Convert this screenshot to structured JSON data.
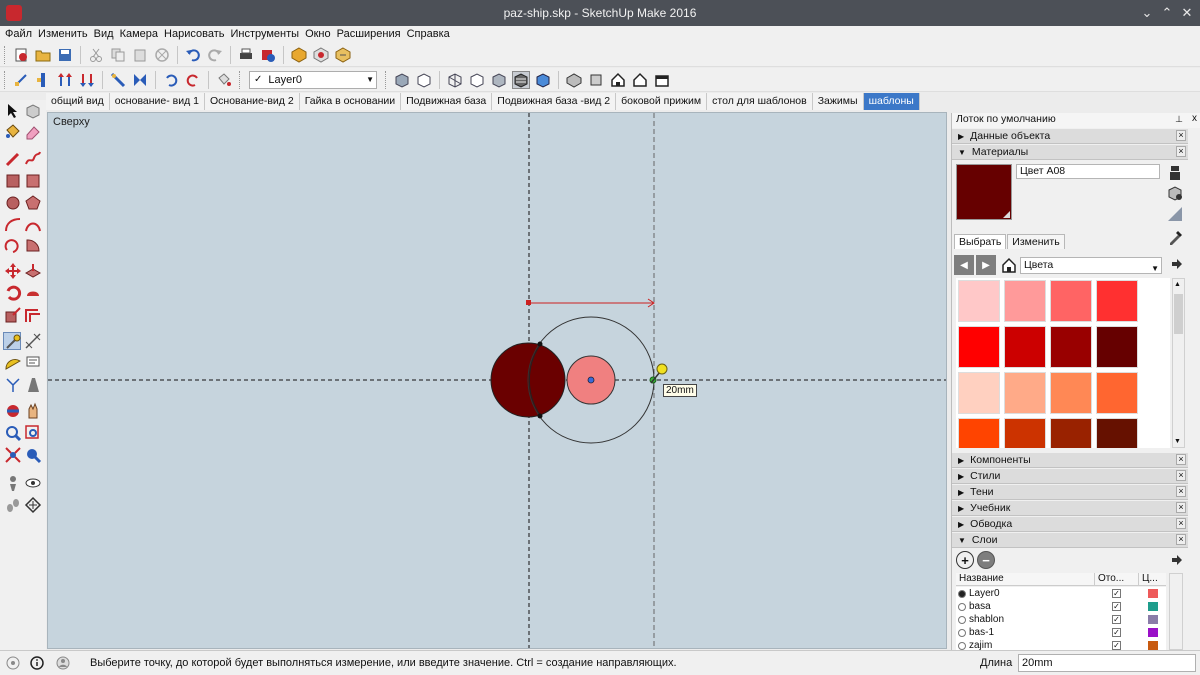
{
  "window": {
    "title": "paz-ship.skp - SketchUp Make 2016",
    "minimize": "⌄",
    "maximize": "⌃",
    "close": "✕"
  },
  "menu": [
    "Файл",
    "Изменить",
    "Вид",
    "Камера",
    "Нарисовать",
    "Инструменты",
    "Окно",
    "Расширения",
    "Справка"
  ],
  "layer_select": {
    "value": "Layer0",
    "check": "✓"
  },
  "scenes": [
    "общий вид",
    "основание- вид 1",
    "Основание-вид 2",
    "Гайка в основании",
    "Подвижная база",
    "Подвижная база -вид 2",
    "боковой прижим",
    "стол для шаблонов",
    "Зажимы",
    "шаблоны"
  ],
  "active_scene": "шаблоны",
  "viewport": {
    "view_label": "Сверху",
    "tooltip": "20mm"
  },
  "tray": {
    "title": "Лоток по умолчанию",
    "pin": "⊥",
    "close": "x",
    "sections": {
      "entity_info": "Данные объекта",
      "materials": "Материалы",
      "components": "Компоненты",
      "styles": "Стили",
      "shadows": "Тени",
      "instructor": "Учебник",
      "outline": "Обводка",
      "layers": "Слои"
    },
    "material_name": "Цвет A08",
    "material_color": "#660000",
    "tabs": [
      "Выбрать",
      "Изменить"
    ],
    "collection": "Цвета",
    "palette": [
      "#ffc8c8",
      "#ff9a9a",
      "#ff6464",
      "#ff3030",
      "#ff0000",
      "#cc0000",
      "#990000",
      "#660000",
      "#ffd0c0",
      "#ffaa88",
      "#ff8855",
      "#ff6630",
      "#ff4400",
      "#cc3300",
      "#992200",
      "#661100"
    ],
    "layers_columns": [
      "Название",
      "Ото...",
      "Ц..."
    ],
    "layers": [
      {
        "name": "Layer0",
        "active": true,
        "visible": "✓",
        "color": "#ee5a5a"
      },
      {
        "name": "basa",
        "active": false,
        "visible": "✓",
        "color": "#1e9d8c"
      },
      {
        "name": "shablon",
        "active": false,
        "visible": "✓",
        "color": "#8a7ca8"
      },
      {
        "name": "bas-1",
        "active": false,
        "visible": "✓",
        "color": "#9a10c8"
      },
      {
        "name": "zajim",
        "active": false,
        "visible": "✓",
        "color": "#c85a10"
      }
    ]
  },
  "status": {
    "message": "Выберите точку, до которой будет выполняться измерение, или введите значение.  Ctrl = создание направляющих.",
    "vcb_label": "Длина",
    "vcb_value": "20mm"
  }
}
